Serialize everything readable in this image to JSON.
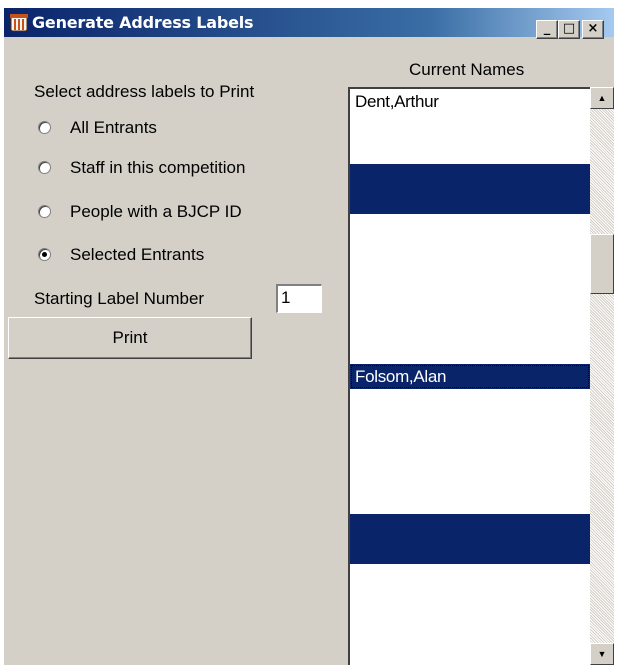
{
  "window": {
    "title": "Generate Address Labels",
    "controls": {
      "minimize": "_",
      "maximize": "□",
      "close": "×"
    }
  },
  "left": {
    "heading": "Select address labels to Print",
    "options": [
      {
        "label": "All Entrants",
        "checked": false
      },
      {
        "label": "Staff in this competition",
        "checked": false
      },
      {
        "label": "People with a BJCP ID",
        "checked": false
      },
      {
        "label": "Selected Entrants",
        "checked": true
      }
    ],
    "start_label": "Starting Label Number",
    "start_value": "1",
    "print_label": "Print"
  },
  "list": {
    "title": "Current Names",
    "items": [
      {
        "text": "Dent,Arthur",
        "selected": false
      },
      {
        "text": "",
        "selected": false
      },
      {
        "text": "",
        "selected": false
      },
      {
        "text": "",
        "selected": true
      },
      {
        "text": "",
        "selected": true
      },
      {
        "text": "",
        "selected": false
      },
      {
        "text": "",
        "selected": false
      },
      {
        "text": "",
        "selected": false
      },
      {
        "text": "",
        "selected": false
      },
      {
        "text": "",
        "selected": false
      },
      {
        "text": "",
        "selected": false
      },
      {
        "text": "Folsom,Alan",
        "selected": true
      },
      {
        "text": "",
        "selected": false
      },
      {
        "text": "",
        "selected": false
      },
      {
        "text": "",
        "selected": false
      },
      {
        "text": "",
        "selected": false
      },
      {
        "text": "",
        "selected": false
      },
      {
        "text": "",
        "selected": true
      },
      {
        "text": "",
        "selected": true
      },
      {
        "text": "",
        "selected": false
      }
    ]
  },
  "colors": {
    "title_bar": "#0a246a",
    "selection": "#0a246a",
    "face": "#d4d0c8"
  }
}
